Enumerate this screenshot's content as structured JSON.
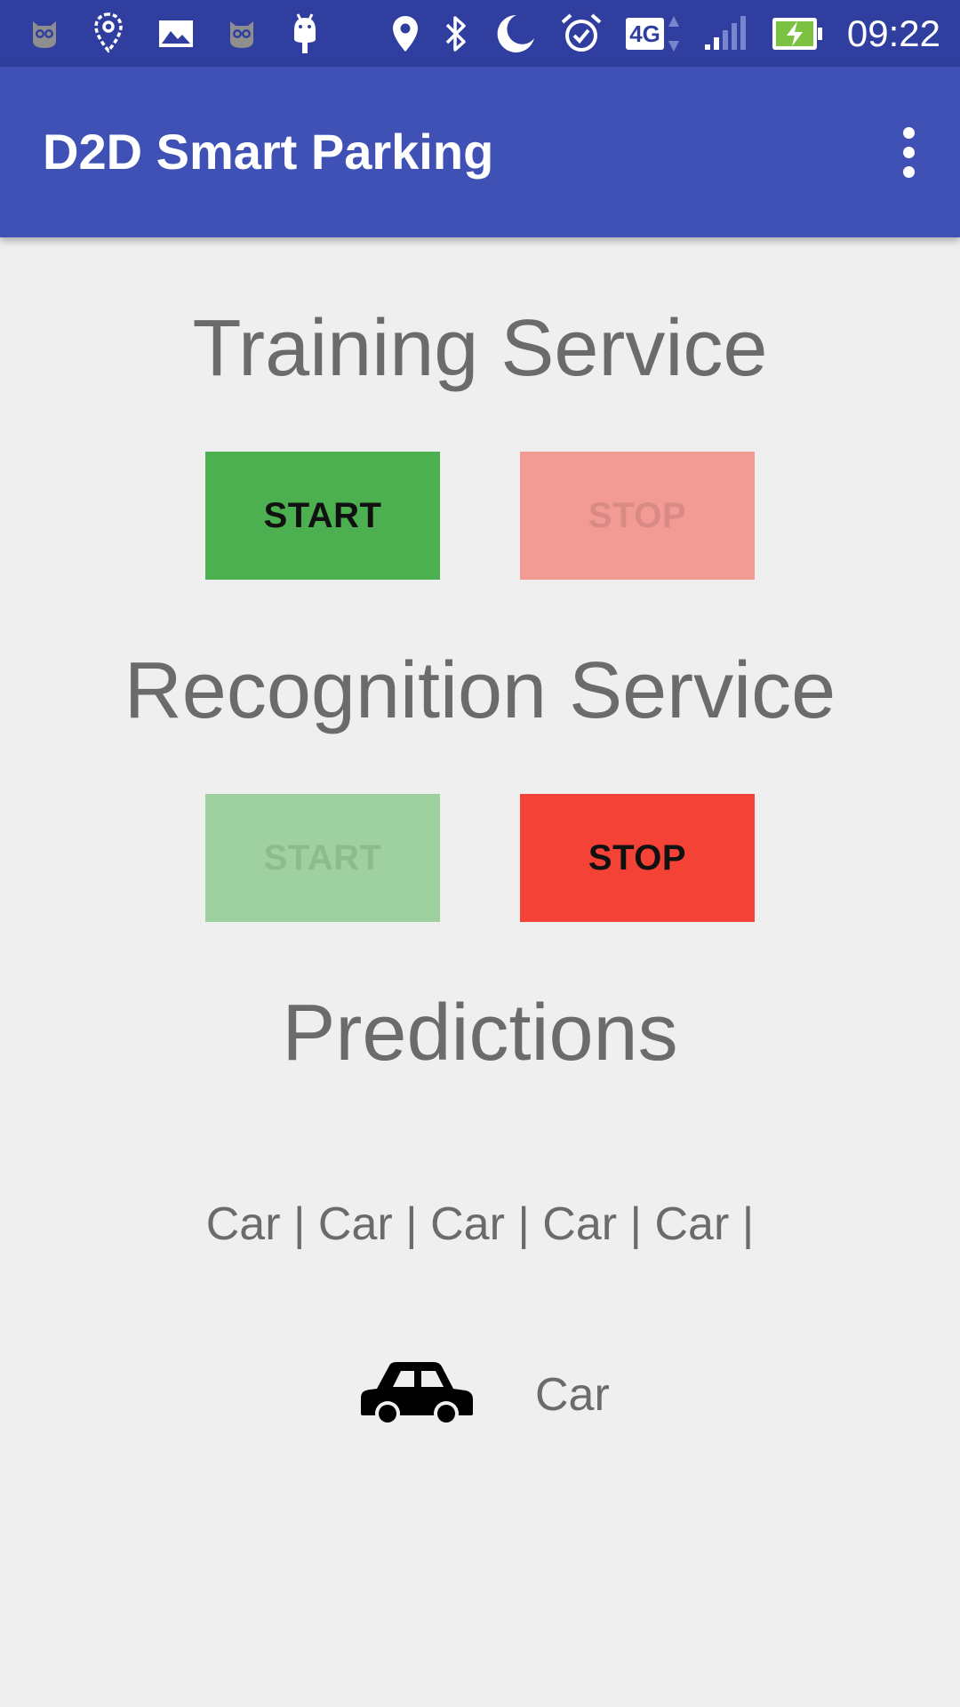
{
  "status_bar": {
    "time": "09:22",
    "network_badge": "4G",
    "icons_left": [
      "owl-icon",
      "location-pin-outline-icon",
      "image-icon",
      "owl-icon",
      "android-icon"
    ],
    "icons_right": [
      "location-icon",
      "bluetooth-icon",
      "moon-icon",
      "alarm-icon",
      "network-4g-icon",
      "signal-icon",
      "battery-charging-icon"
    ]
  },
  "app_bar": {
    "title": "D2D Smart Parking",
    "overflow_icon": "more-vert-icon"
  },
  "training": {
    "heading": "Training Service",
    "start_label": "START",
    "stop_label": "STOP"
  },
  "recognition": {
    "heading": "Recognition Service",
    "start_label": "START",
    "stop_label": "STOP"
  },
  "predictions": {
    "heading": "Predictions",
    "history": "Car | Car | Car | Car | Car |",
    "current_icon": "car-icon",
    "current_label": "Car"
  },
  "colors": {
    "status_bar": "#303f9f",
    "app_bar": "#3f51b5",
    "start_enabled": "#4caf50",
    "start_disabled": "#9fd09f",
    "stop_enabled": "#f44336",
    "stop_disabled": "#f29a94",
    "background": "#efefef"
  }
}
